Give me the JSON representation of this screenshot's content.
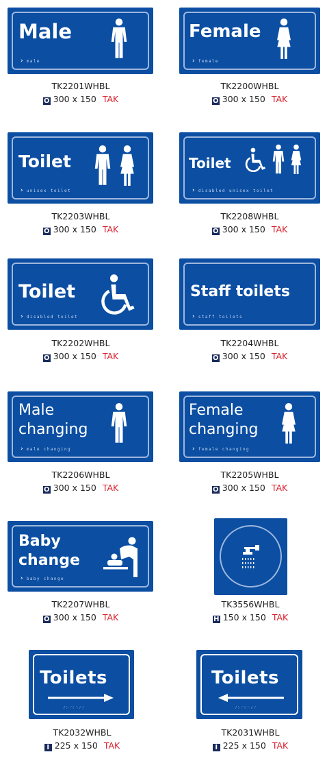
{
  "colors": {
    "sign_blue": "#0b4ea2",
    "badge_navy": "#1a2b5b",
    "tak_red": "#d81e2a"
  },
  "products": [
    {
      "title": "Male",
      "small": "male",
      "code": "TK2201WHBL",
      "badge": "O",
      "size": "300 x 150",
      "tak": "TAK",
      "icon": "man-icon"
    },
    {
      "title": "Female",
      "small": "female",
      "code": "TK2200WHBL",
      "badge": "O",
      "size": "300 x 150",
      "tak": "TAK",
      "icon": "woman-icon"
    },
    {
      "title": "Toilet",
      "small": "unisex toilet",
      "code": "TK2203WHBL",
      "badge": "O",
      "size": "300 x 150",
      "tak": "TAK",
      "icon": "man-woman-icon"
    },
    {
      "title": "Toilet",
      "small": "disabled unisex toilet",
      "code": "TK2208WHBL",
      "badge": "O",
      "size": "300 x 150",
      "tak": "TAK",
      "icon": "wheelchair-man-woman-icon"
    },
    {
      "title": "Toilet",
      "small": "disabled toilet",
      "code": "TK2202WHBL",
      "badge": "O",
      "size": "300 x 150",
      "tak": "TAK",
      "icon": "wheelchair-icon"
    },
    {
      "title": "Staff toilets",
      "small": "staff toilets",
      "code": "TK2204WHBL",
      "badge": "O",
      "size": "300 x 150",
      "tak": "TAK",
      "icon": ""
    },
    {
      "title_line1": "Male",
      "title_line2": "changing",
      "small": "male changing",
      "code": "TK2206WHBL",
      "badge": "O",
      "size": "300 x 150",
      "tak": "TAK",
      "icon": "man-icon"
    },
    {
      "title_line1": "Female",
      "title_line2": "changing",
      "small": "female changing",
      "code": "TK2205WHBL",
      "badge": "O",
      "size": "300 x 150",
      "tak": "TAK",
      "icon": "woman-icon"
    },
    {
      "title_line1": "Baby",
      "title_line2": "change",
      "small": "baby change",
      "code": "TK2207WHBL",
      "badge": "O",
      "size": "300 x 150",
      "tak": "TAK",
      "icon": "baby-change-icon"
    },
    {
      "code": "TK3556WHBL",
      "badge": "H",
      "size": "150 x 150",
      "tak": "TAK",
      "icon": "shower-icon"
    },
    {
      "title": "Toilets",
      "code": "TK2032WHBL",
      "badge": "I",
      "size": "225 x 150",
      "tak": "TAK",
      "icon": "arrow-right-icon"
    },
    {
      "title": "Toilets",
      "code": "TK2031WHBL",
      "badge": "I",
      "size": "225 x 150",
      "tak": "TAK",
      "icon": "arrow-left-icon"
    }
  ]
}
